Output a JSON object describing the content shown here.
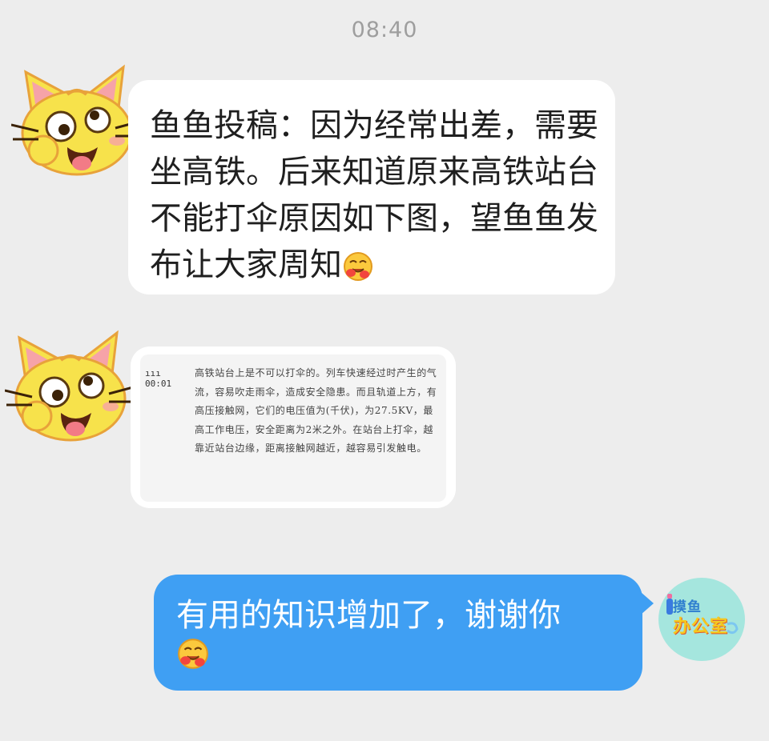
{
  "status": {
    "time": "08:40"
  },
  "messages": [
    {
      "sender": "other",
      "avatar_icon": "cat-face-icon",
      "type": "text",
      "text": "鱼鱼投稿：因为经常出差，需要坐高铁。后来知道原来高铁站台不能打伞原因如下图，望鱼鱼发布让大家周知",
      "emoji_icon": "hugging-face-emoji-icon"
    },
    {
      "sender": "other",
      "avatar_icon": "cat-face-icon",
      "type": "image",
      "image_meta": "ııı 00:01",
      "image_text": "高铁站台上是不可以打伞的。列车快速经过时产生的气流，容易吹走雨伞，造成安全隐患。而且轨道上方，有高压接触网，它们的电压值为(千伏)，为27.5KV，最高工作电压，安全距离为2米之外。在站台上打伞，越靠近站台边缘，距离接触网越近，越容易引发触电。"
    },
    {
      "sender": "self",
      "avatar_icon": "logo-icon",
      "logo_text_top": "摸鱼",
      "logo_text_bottom": "办公室",
      "type": "text",
      "text": "有用的知识增加了，谢谢你",
      "emoji_icon": "hugging-face-emoji-icon"
    }
  ],
  "colors": {
    "background": "#ededed",
    "bubble_other": "#ffffff",
    "bubble_self": "#3f9ff3",
    "time_text": "#9e9e9e"
  }
}
